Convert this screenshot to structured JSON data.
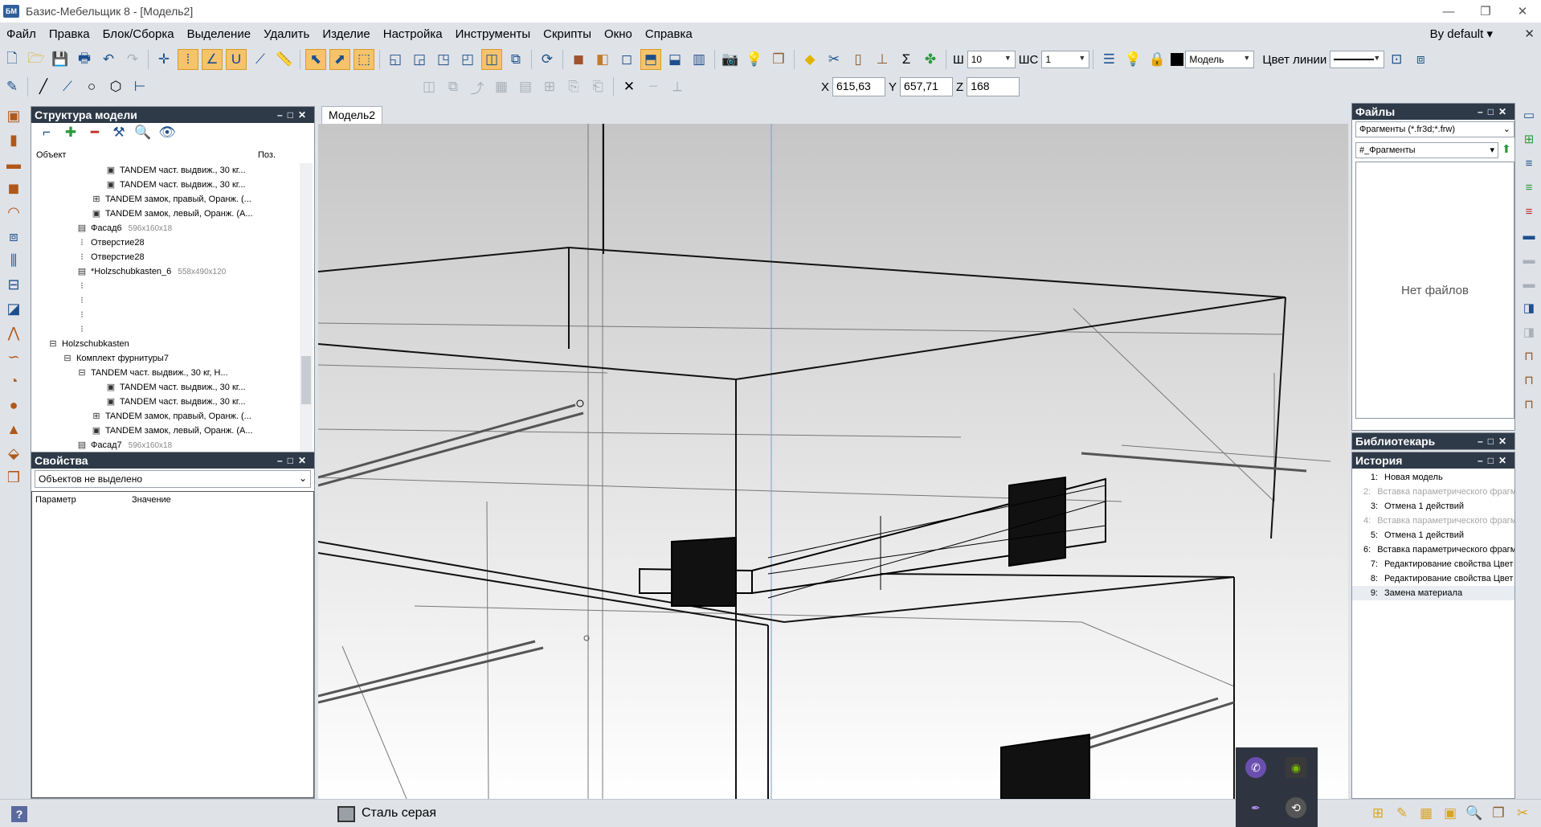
{
  "window": {
    "title": "Базис-Мебельщик 8 - [Модель2]",
    "app_badge": "БМ",
    "controls": [
      "—",
      "❐",
      "✕"
    ]
  },
  "menu": {
    "items": [
      "Файл",
      "Правка",
      "Блок/Сборка",
      "Выделение",
      "Удалить",
      "Изделие",
      "Настройка",
      "Инструменты",
      "Скрипты",
      "Окно",
      "Справка"
    ],
    "profile": "By default",
    "close": "✕"
  },
  "toolbar": {
    "w_label": "Ш",
    "w_value": "10",
    "shs_label": "ШС",
    "shs_value": "1",
    "layer_value": "Модель",
    "line_color_label": "Цвет линии"
  },
  "coords": {
    "x_label": "X",
    "x": "615,63",
    "y_label": "Y",
    "y": "657,71",
    "z_label": "Z",
    "z": "168"
  },
  "structure": {
    "title": "Структура модели",
    "col_object": "Объект",
    "col_pos": "Поз.",
    "rows": [
      {
        "indent": 5,
        "icon": "▣",
        "label": "TANDEM част. выдвиж., 30 кг...",
        "dim": ""
      },
      {
        "indent": 5,
        "icon": "▣",
        "label": "TANDEM част. выдвиж., 30 кг...",
        "dim": ""
      },
      {
        "indent": 4,
        "icon": "⊞",
        "label": "TANDEM замок, правый, Оранж. (...",
        "dim": ""
      },
      {
        "indent": 4,
        "icon": "▣",
        "label": "TANDEM замок, левый, Оранж. (А...",
        "dim": ""
      },
      {
        "indent": 3,
        "icon": "▤",
        "label": "Фасад6",
        "dim": "596x160x18"
      },
      {
        "indent": 3,
        "icon": "⁝",
        "label": "Отверстие28",
        "dim": ""
      },
      {
        "indent": 3,
        "icon": "⁝",
        "label": "Отверстие28",
        "dim": ""
      },
      {
        "indent": 3,
        "icon": "▤",
        "label": "*Holzschubkasten_6",
        "dim": "558x490x120"
      },
      {
        "indent": 3,
        "icon": "⁝",
        "label": "",
        "dim": ""
      },
      {
        "indent": 3,
        "icon": "⁝",
        "label": "",
        "dim": ""
      },
      {
        "indent": 3,
        "icon": "⁝",
        "label": "",
        "dim": ""
      },
      {
        "indent": 3,
        "icon": "⁝",
        "label": "",
        "dim": ""
      },
      {
        "indent": 1,
        "icon": "⊟",
        "label": "Holzschubkasten",
        "dim": ""
      },
      {
        "indent": 2,
        "icon": "⊟",
        "label": "Комплект фурнитуры7",
        "dim": ""
      },
      {
        "indent": 3,
        "icon": "⊟",
        "label": "TANDEM част. выдвиж., 30 кг, Н...",
        "dim": ""
      },
      {
        "indent": 5,
        "icon": "▣",
        "label": "TANDEM част. выдвиж., 30 кг...",
        "dim": ""
      },
      {
        "indent": 5,
        "icon": "▣",
        "label": "TANDEM част. выдвиж., 30 кг...",
        "dim": ""
      },
      {
        "indent": 4,
        "icon": "⊞",
        "label": "TANDEM замок, правый, Оранж. (...",
        "dim": ""
      },
      {
        "indent": 4,
        "icon": "▣",
        "label": "TANDEM замок, левый, Оранж. (А...",
        "dim": ""
      },
      {
        "indent": 3,
        "icon": "▤",
        "label": "Фасад7",
        "dim": "596x160x18"
      }
    ]
  },
  "properties": {
    "title": "Свойства",
    "selection": "Объектов не выделено",
    "col_param": "Параметр",
    "col_value": "Значение"
  },
  "document": {
    "tab": "Модель2"
  },
  "files": {
    "title": "Файлы",
    "filter": "Фрагменты (*.fr3d;*.frw)",
    "folder": "#_Фрагменты",
    "empty": "Нет файлов"
  },
  "librarian": {
    "title": "Библиотекарь"
  },
  "history": {
    "title": "История",
    "items": [
      {
        "n": "1:",
        "label": "Новая модель",
        "disabled": false
      },
      {
        "n": "2:",
        "label": "Вставка параметрического фрагм",
        "disabled": true
      },
      {
        "n": "3:",
        "label": "Отмена 1 действий",
        "disabled": false
      },
      {
        "n": "4:",
        "label": "Вставка параметрического фрагм",
        "disabled": true
      },
      {
        "n": "5:",
        "label": "Отмена 1 действий",
        "disabled": false
      },
      {
        "n": "6:",
        "label": "Вставка параметрического фрагм",
        "disabled": false
      },
      {
        "n": "7:",
        "label": "Редактирование свойства Цвет",
        "disabled": false
      },
      {
        "n": "8:",
        "label": "Редактирование свойства Цвет",
        "disabled": false
      },
      {
        "n": "9:",
        "label": "Замена материала",
        "disabled": false
      }
    ]
  },
  "status": {
    "help": "?",
    "material": "Сталь серая"
  },
  "colors": {
    "panel_header": "#2e3a48",
    "selected_tool": "#f6c36a",
    "chrome": "#dfe3e8"
  },
  "panel_controls": "–□✕"
}
